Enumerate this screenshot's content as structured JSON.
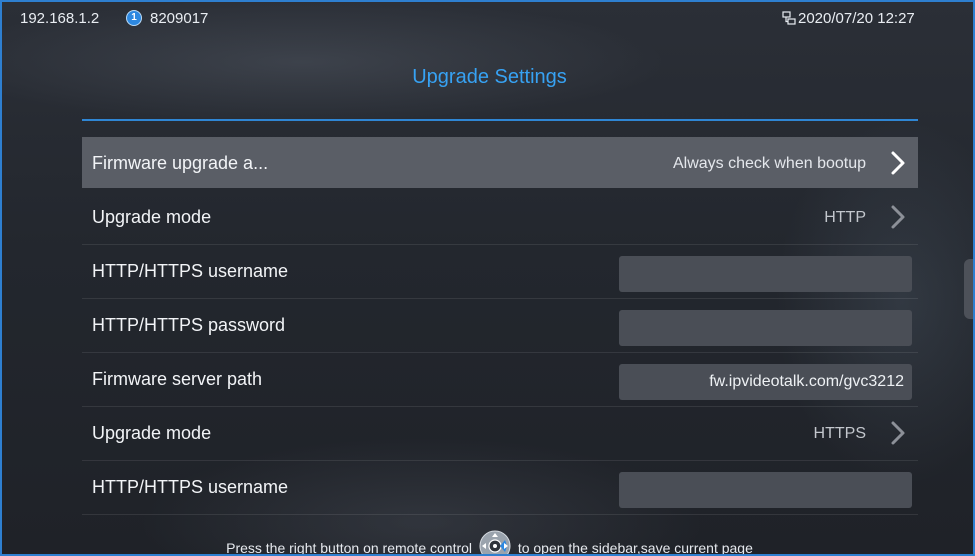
{
  "status_bar": {
    "ip": "192.168.1.2",
    "account": "8209017",
    "account_icon_glyph": "1",
    "datetime": "2020/07/20 12:27"
  },
  "page": {
    "title": "Upgrade Settings"
  },
  "rows": [
    {
      "label": "Firmware upgrade a...",
      "value": "Always check when bootup",
      "kind": "select",
      "selected": true
    },
    {
      "label": "Upgrade mode",
      "value": "HTTP",
      "kind": "select"
    },
    {
      "label": "HTTP/HTTPS username",
      "value": "",
      "kind": "input"
    },
    {
      "label": "HTTP/HTTPS password",
      "value": "",
      "kind": "input"
    },
    {
      "label": "Firmware server path",
      "value": "fw.ipvideotalk.com/gvc3212",
      "kind": "input"
    },
    {
      "label": "Upgrade mode",
      "value": "HTTPS",
      "kind": "select"
    },
    {
      "label": "HTTP/HTTPS username",
      "value": "",
      "kind": "input"
    }
  ],
  "hint": {
    "before": "Press the right button on remote control",
    "after": "to open the sidebar,save current page"
  },
  "icons": {
    "account": "account-icon",
    "network": "network-icon",
    "chevron": "chevron-right-icon",
    "remote": "remote-control-icon"
  },
  "colors": {
    "accent": "#37a2f3",
    "selected_row": "#5a5e66",
    "input_bg": "#4a4e56",
    "background": "#23272e"
  }
}
